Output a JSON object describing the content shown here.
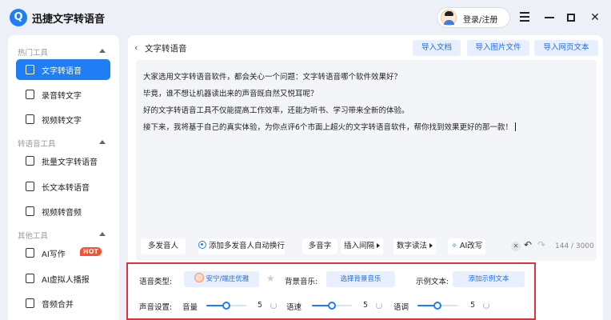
{
  "app": {
    "logo_glyph": "Q",
    "title": "迅捷文字转语音"
  },
  "header": {
    "login_label": "登录/注册"
  },
  "window_controls": {
    "close_glyph": "✕"
  },
  "sidebar": {
    "sections": [
      {
        "title": "热门工具",
        "items": [
          {
            "label": "文字转语音",
            "active": true
          },
          {
            "label": "录音转文字"
          },
          {
            "label": "视频转文字"
          }
        ]
      },
      {
        "title": "转语音工具",
        "items": [
          {
            "label": "批量文字转语音"
          },
          {
            "label": "长文本转语音"
          },
          {
            "label": "视频转音频"
          }
        ]
      },
      {
        "title": "其他工具",
        "items": [
          {
            "label": "AI写作",
            "badge": "HOT"
          },
          {
            "label": "AI虚拟人播报"
          },
          {
            "label": "音频合并"
          }
        ]
      }
    ]
  },
  "main": {
    "back_glyph": "‹",
    "title": "文字转语音",
    "import_buttons": [
      "导入文档",
      "导入图片文件",
      "导入网页文本"
    ],
    "editor_lines": [
      "大家选用文字转语音软件，都会关心一个问题：文字转语音哪个软件效果好？",
      "毕竟，谁不想让机器读出来的声音既自然又悦耳呢？",
      "好的文字转语音工具不仅能提高工作效率，还能为听书、学习带来全新的体验。",
      "接下来，我将基于自己的真实体验，为你点评6个市面上超火的文字转语音软件，帮你找到效果更好的那一款！"
    ],
    "toolbar": {
      "multi_speaker": "多发音人",
      "auto_newline": "添加多发音人自动换行",
      "polyphone": "多音字",
      "insert_pause": "插入间隔",
      "number_reading": "数字读法",
      "ai_rewrite": "AI改写",
      "clear_glyph": "✕",
      "undo_glyph": "↶",
      "redo_glyph": "↷",
      "char_count": "144 / 3000"
    }
  },
  "settings": {
    "voice_type_label": "语音类型:",
    "voice_name": "安宁/端庄优雅",
    "star_glyph": "★",
    "bgm_label": "背景音乐:",
    "bgm_select": "选择背景音乐",
    "sample_label": "示例文本:",
    "sample_add": "添加示例文本",
    "sound_label": "声音设置:",
    "volume_label": "音量",
    "volume_value": "5",
    "speed_label": "语速",
    "speed_value": "5",
    "pitch_label": "语调",
    "pitch_value": "5",
    "slider_level_fraction": 0.5
  },
  "colors": {
    "accent": "#1f7ef3",
    "highlight_border": "#e0303a",
    "hot_badge": "#ff4d2e"
  }
}
